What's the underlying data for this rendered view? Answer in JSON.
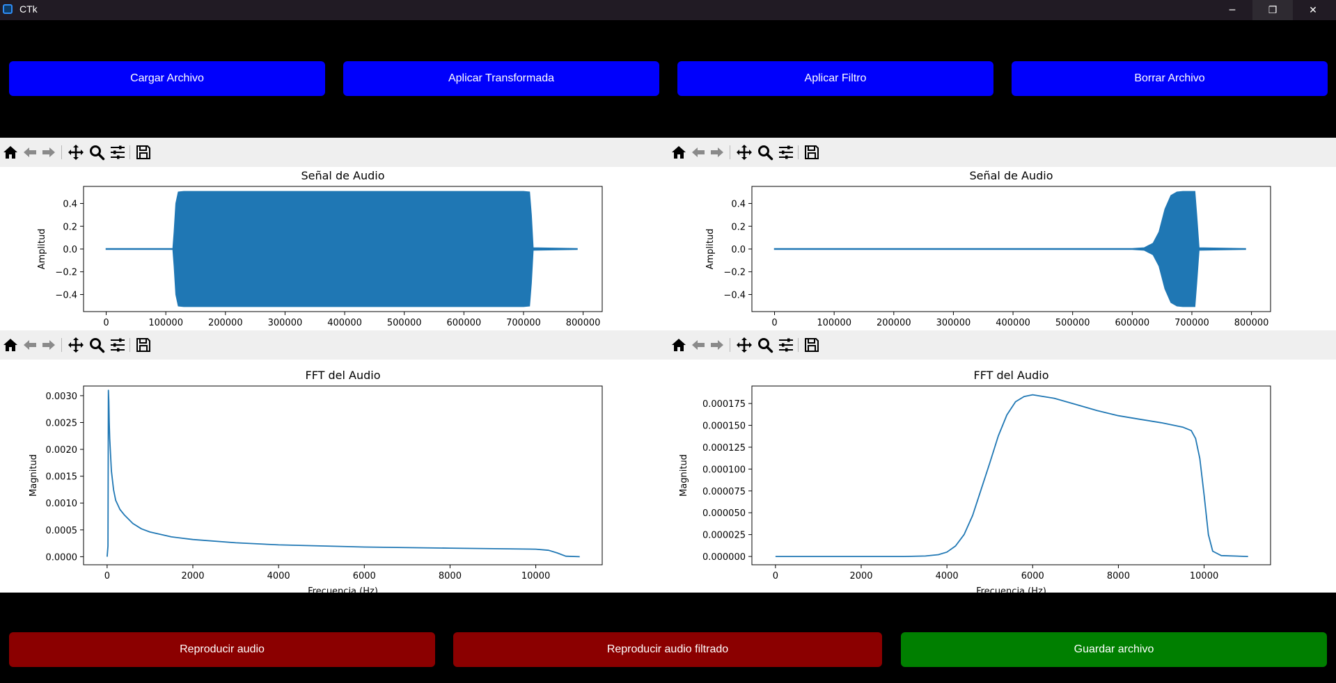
{
  "window": {
    "title": "CTk",
    "minimize_glyph": "─",
    "restore_glyph": "❐",
    "close_glyph": "✕"
  },
  "top_buttons": [
    "Cargar Archivo",
    "Aplicar Transformada",
    "Aplicar Filtro",
    "Borrar Archivo"
  ],
  "bottom_buttons": [
    {
      "label": "Reproducir audio",
      "color": "#8b0000"
    },
    {
      "label": "Reproducir audio filtrado",
      "color": "#8b0000"
    },
    {
      "label": "Guardar archivo",
      "color": "#007f00"
    }
  ],
  "toolbar_icons": [
    "home-icon",
    "back-arrow-icon",
    "forward-arrow-icon",
    "pan-icon",
    "zoom-icon",
    "subplots-icon",
    "save-icon"
  ],
  "accent_color": "#0000fc",
  "line_color": "#1f77b4",
  "chart_data": [
    {
      "id": "original_signal",
      "type": "area",
      "title": "Señal de Audio",
      "xlabel": "",
      "ylabel": "Amplitud",
      "xlim": [
        -38000,
        832000
      ],
      "ylim": [
        -0.55,
        0.55
      ],
      "xticks": [
        0,
        100000,
        200000,
        300000,
        400000,
        500000,
        600000,
        700000,
        800000
      ],
      "xtick_labels": [
        "0",
        "100000",
        "200000",
        "300000",
        "400000",
        "500000",
        "600000",
        "700000",
        "800000"
      ],
      "yticks": [
        0.4,
        0.2,
        0.0,
        -0.2,
        -0.4
      ],
      "ytick_labels": [
        "0.4",
        "0.2",
        "0.0",
        "−0.2",
        "−0.4"
      ],
      "envelope": [
        [
          0,
          0.003
        ],
        [
          112000,
          0.003
        ],
        [
          114000,
          0.15
        ],
        [
          117000,
          0.4
        ],
        [
          121000,
          0.5
        ],
        [
          130000,
          0.505
        ],
        [
          700000,
          0.505
        ],
        [
          710000,
          0.5
        ],
        [
          713000,
          0.3
        ],
        [
          716000,
          0.01
        ],
        [
          790000,
          0.003
        ]
      ]
    },
    {
      "id": "filtered_signal",
      "type": "area",
      "title": "Señal de Audio",
      "xlabel": "",
      "ylabel": "Amplitud",
      "xlim": [
        -38000,
        832000
      ],
      "ylim": [
        -0.55,
        0.55
      ],
      "xticks": [
        0,
        100000,
        200000,
        300000,
        400000,
        500000,
        600000,
        700000,
        800000
      ],
      "xtick_labels": [
        "0",
        "100000",
        "200000",
        "300000",
        "400000",
        "500000",
        "600000",
        "700000",
        "800000"
      ],
      "yticks": [
        0.4,
        0.2,
        0.0,
        -0.2,
        -0.4
      ],
      "ytick_labels": [
        "0.4",
        "0.2",
        "0.0",
        "−0.2",
        "−0.4"
      ],
      "envelope": [
        [
          0,
          0.003
        ],
        [
          600000,
          0.003
        ],
        [
          620000,
          0.01
        ],
        [
          635000,
          0.05
        ],
        [
          645000,
          0.15
        ],
        [
          655000,
          0.35
        ],
        [
          665000,
          0.47
        ],
        [
          675000,
          0.5
        ],
        [
          685000,
          0.505
        ],
        [
          705000,
          0.505
        ],
        [
          708000,
          0.3
        ],
        [
          712000,
          0.01
        ],
        [
          790000,
          0.003
        ]
      ]
    },
    {
      "id": "original_fft",
      "type": "line",
      "title": "FFT del Audio",
      "xlabel": "Frecuencia (Hz)",
      "ylabel": "Magnitud",
      "xlim": [
        -550,
        11550
      ],
      "ylim": [
        -0.00015,
        0.00318
      ],
      "xticks": [
        0,
        2000,
        4000,
        6000,
        8000,
        10000
      ],
      "xtick_labels": [
        "0",
        "2000",
        "4000",
        "6000",
        "8000",
        "10000"
      ],
      "yticks": [
        0.003,
        0.0025,
        0.002,
        0.0015,
        0.001,
        0.0005,
        0.0
      ],
      "ytick_labels": [
        "0.0030",
        "0.0025",
        "0.0020",
        "0.0015",
        "0.0010",
        "0.0005",
        "0.0000"
      ],
      "x": [
        0,
        20,
        30,
        40,
        50,
        60,
        80,
        100,
        150,
        200,
        300,
        400,
        600,
        800,
        1000,
        1500,
        2000,
        3000,
        4000,
        6000,
        8000,
        10000,
        10300,
        10500,
        10700,
        11025
      ],
      "y": [
        0.0,
        0.0002,
        0.0031,
        0.0029,
        0.0025,
        0.0022,
        0.0019,
        0.0016,
        0.00125,
        0.00105,
        0.00088,
        0.00078,
        0.00062,
        0.00052,
        0.00046,
        0.00037,
        0.00032,
        0.00026,
        0.00022,
        0.00018,
        0.00016,
        0.00014,
        0.00012,
        7e-05,
        1e-05,
        0.0
      ]
    },
    {
      "id": "filtered_fft",
      "type": "line",
      "title": "FFT del Audio",
      "xlabel": "Frecuencia (Hz)",
      "ylabel": "Magnitud",
      "xlim": [
        -550,
        11550
      ],
      "ylim": [
        -9.5e-06,
        0.000195
      ],
      "xticks": [
        0,
        2000,
        4000,
        6000,
        8000,
        10000
      ],
      "xtick_labels": [
        "0",
        "2000",
        "4000",
        "6000",
        "8000",
        "10000"
      ],
      "yticks": [
        0.000175,
        0.00015,
        0.000125,
        0.0001,
        7.5e-05,
        5e-05,
        2.5e-05,
        0.0
      ],
      "ytick_labels": [
        "0.000175",
        "0.000150",
        "0.000125",
        "0.000100",
        "0.000075",
        "0.000050",
        "0.000025",
        "0.000000"
      ],
      "x": [
        0,
        3000,
        3500,
        3800,
        4000,
        4200,
        4400,
        4600,
        4800,
        5000,
        5200,
        5400,
        5600,
        5800,
        6000,
        6500,
        7000,
        7500,
        8000,
        8500,
        9000,
        9500,
        9700,
        9800,
        9900,
        10000,
        10100,
        10200,
        10400,
        11025
      ],
      "y": [
        0,
        0,
        5e-07,
        2e-06,
        5e-06,
        1.2e-05,
        2.5e-05,
        4.7e-05,
        7.7e-05,
        0.000107,
        0.000138,
        0.000162,
        0.000177,
        0.000183,
        0.000185,
        0.000181,
        0.000174,
        0.000167,
        0.000161,
        0.000157,
        0.000153,
        0.000148,
        0.000144,
        0.000135,
        0.000112,
        7e-05,
        2.5e-05,
        6e-06,
        1e-06,
        0
      ]
    }
  ]
}
